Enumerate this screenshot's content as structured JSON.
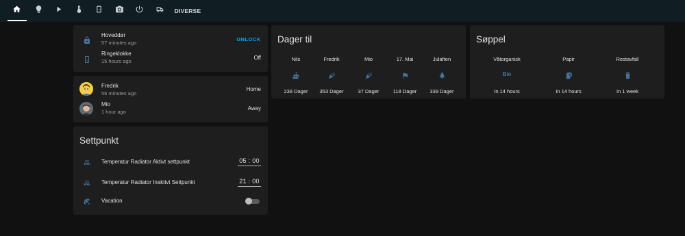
{
  "nav": {
    "tabs": [
      {
        "icon": "home-icon"
      },
      {
        "icon": "lightbulb-icon"
      },
      {
        "icon": "play-icon"
      },
      {
        "icon": "thermometer-icon"
      },
      {
        "icon": "door-icon"
      },
      {
        "icon": "camera-icon"
      },
      {
        "icon": "power-icon"
      },
      {
        "icon": "van-icon"
      }
    ],
    "diverse_label": "DIVERSE"
  },
  "door_card": {
    "lock_name": "Hoveddør",
    "lock_time": "57 minutes ago",
    "lock_action": "UNLOCK",
    "bell_name": "Ringeklokke",
    "bell_time": "15 hours ago",
    "bell_state": "Off"
  },
  "people_card": {
    "p1_name": "Fredrik",
    "p1_time": "56 minutes ago",
    "p1_state": "Home",
    "p2_name": "Mio",
    "p2_time": "1 hour ago",
    "p2_state": "Away"
  },
  "settpunkt_card": {
    "title": "Settpunkt",
    "r1_name": "Temperatur Radiator Aktivt settpunkt",
    "r1_time": "05 : 00",
    "r2_name": "Temperatur Radiator Inaktivt Settpunkt",
    "r2_time": "21 : 00",
    "r3_name": "Vacation",
    "r3_on": false
  },
  "dager_card": {
    "title": "Dager til",
    "cols": [
      {
        "label": "Nils",
        "icon": "cake-icon",
        "value": "238 Dager"
      },
      {
        "label": "Fredrik",
        "icon": "party-popper-icon",
        "value": "353 Dager"
      },
      {
        "label": "Mio",
        "icon": "party-popper-icon",
        "value": "37 Dager"
      },
      {
        "label": "17. Mai",
        "icon": "flag-icon",
        "value": "118 Dager"
      },
      {
        "label": "Julaften",
        "icon": "pine-tree-icon",
        "value": "339 Dager"
      }
    ]
  },
  "soppel_card": {
    "title": "Søppel",
    "cols": [
      {
        "label": "Våtorganisk",
        "icon": "bio-icon",
        "icon_text": "Bio",
        "value": "In 14 hours"
      },
      {
        "label": "Papir",
        "icon": "paper-icon",
        "value": "In 14 hours"
      },
      {
        "label": "Restavfall",
        "icon": "trash-icon",
        "value": "In 1 week"
      }
    ]
  },
  "colors": {
    "background": "#111111",
    "topbar": "#101e24",
    "card": "#1e1e1e",
    "icon": "#44739e",
    "accent": "#03a9f4"
  }
}
